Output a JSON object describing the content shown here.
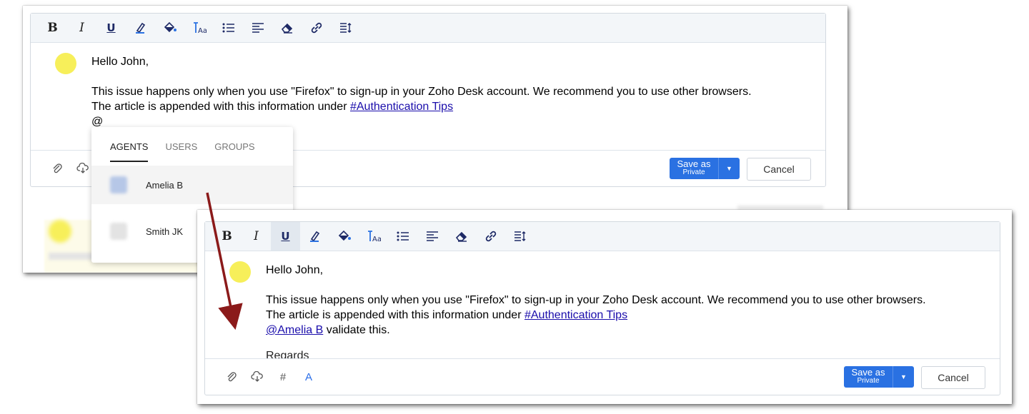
{
  "toolbar": {
    "bold": "B",
    "italic": "I",
    "underline": "U",
    "icons": [
      "text-color-icon",
      "fill-color-icon",
      "font-size-icon",
      "bullet-list-icon",
      "align-left-icon",
      "eraser-icon",
      "link-icon",
      "line-height-icon"
    ],
    "font_size_label": "Aa"
  },
  "message": {
    "greeting": "Hello John,",
    "line1": "This issue happens only when you use \"Firefox\" to sign-up in your Zoho Desk account. We recommend you to use other browsers.",
    "line2_prefix": "The article is appended with this information under ",
    "hashtag": "#Authentication Tips",
    "at_sign": "@",
    "mention": "@Amelia B",
    "mention_suffix": " validate this.",
    "regards": "Regards"
  },
  "mention_popup": {
    "tabs": [
      "AGENTS",
      "USERS",
      "GROUPS"
    ],
    "agents": [
      "Amelia B",
      "Smith JK"
    ]
  },
  "footer": {
    "save_label": "Save as",
    "save_sub": "Private",
    "cancel_label": "Cancel",
    "hash_label": "#",
    "font_label": "A"
  },
  "colors": {
    "accent": "#2a71e2",
    "avatar": "#f7ef5a",
    "arrow": "#8b1a1a",
    "link": "#1a0dab"
  }
}
